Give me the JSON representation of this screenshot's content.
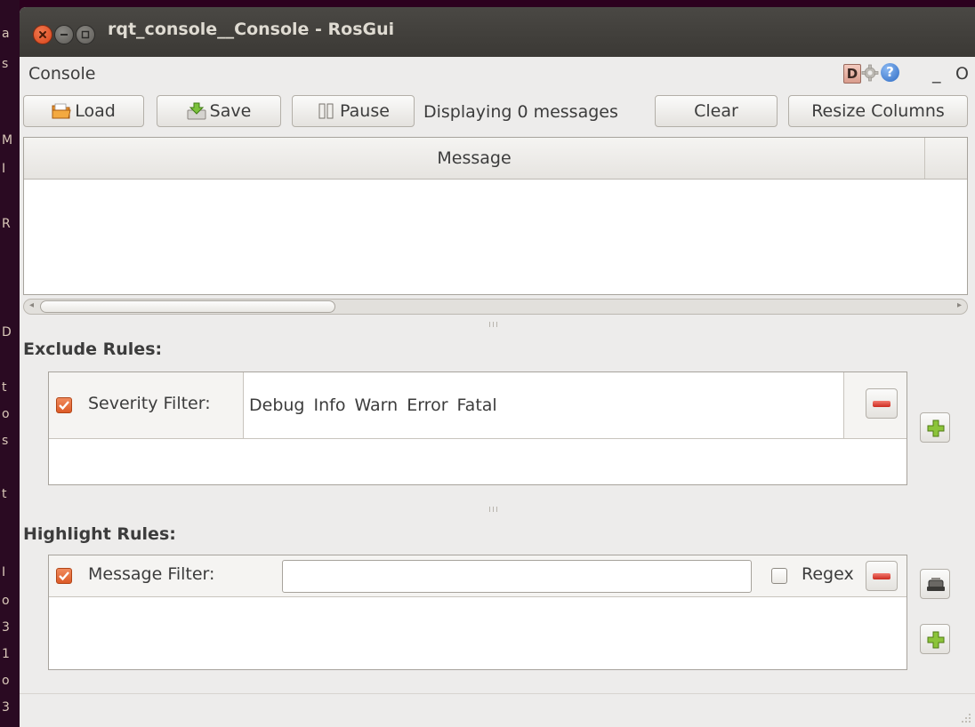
{
  "desktop_fragments": [
    "a",
    "s",
    "M",
    "I",
    "R",
    "D",
    "t",
    "o",
    "s",
    "t",
    "I",
    "o",
    "3",
    "1",
    "o",
    "3"
  ],
  "window": {
    "title": "rqt_console__Console - RosGui"
  },
  "pane": {
    "title": "Console",
    "debug_icon_letter": "D",
    "help_icon_glyph": "?",
    "minimize_label": "_",
    "close_label": "O"
  },
  "toolbar": {
    "load_label": "Load",
    "save_label": "Save",
    "pause_label": "Pause",
    "status_text": "Displaying 0 messages",
    "clear_label": "Clear",
    "resize_label": "Resize Columns"
  },
  "table": {
    "columns": [
      "Message"
    ]
  },
  "exclude": {
    "heading": "Exclude Rules:",
    "severity_label": "Severity Filter:",
    "levels": [
      "Debug",
      "Info",
      "Warn",
      "Error",
      "Fatal"
    ],
    "checked": true
  },
  "highlight": {
    "heading": "Highlight Rules:",
    "message_label": "Message Filter:",
    "message_value": "",
    "regex_label": "Regex",
    "regex_checked": false,
    "checked": true
  },
  "icons": [
    "close-icon",
    "minimize-icon",
    "maximize-icon",
    "folder-icon",
    "save-icon",
    "pause-icon",
    "gear-icon",
    "help-icon",
    "minus-icon",
    "plus-icon",
    "eraser-icon"
  ],
  "colors": {
    "titlebar": "#3c3b37",
    "close_button": "#e0521f",
    "checkbox": "#e0642f",
    "minus_button": "#d9362b",
    "plus_button": "#8cc43a",
    "window_bg": "#edeceb"
  }
}
